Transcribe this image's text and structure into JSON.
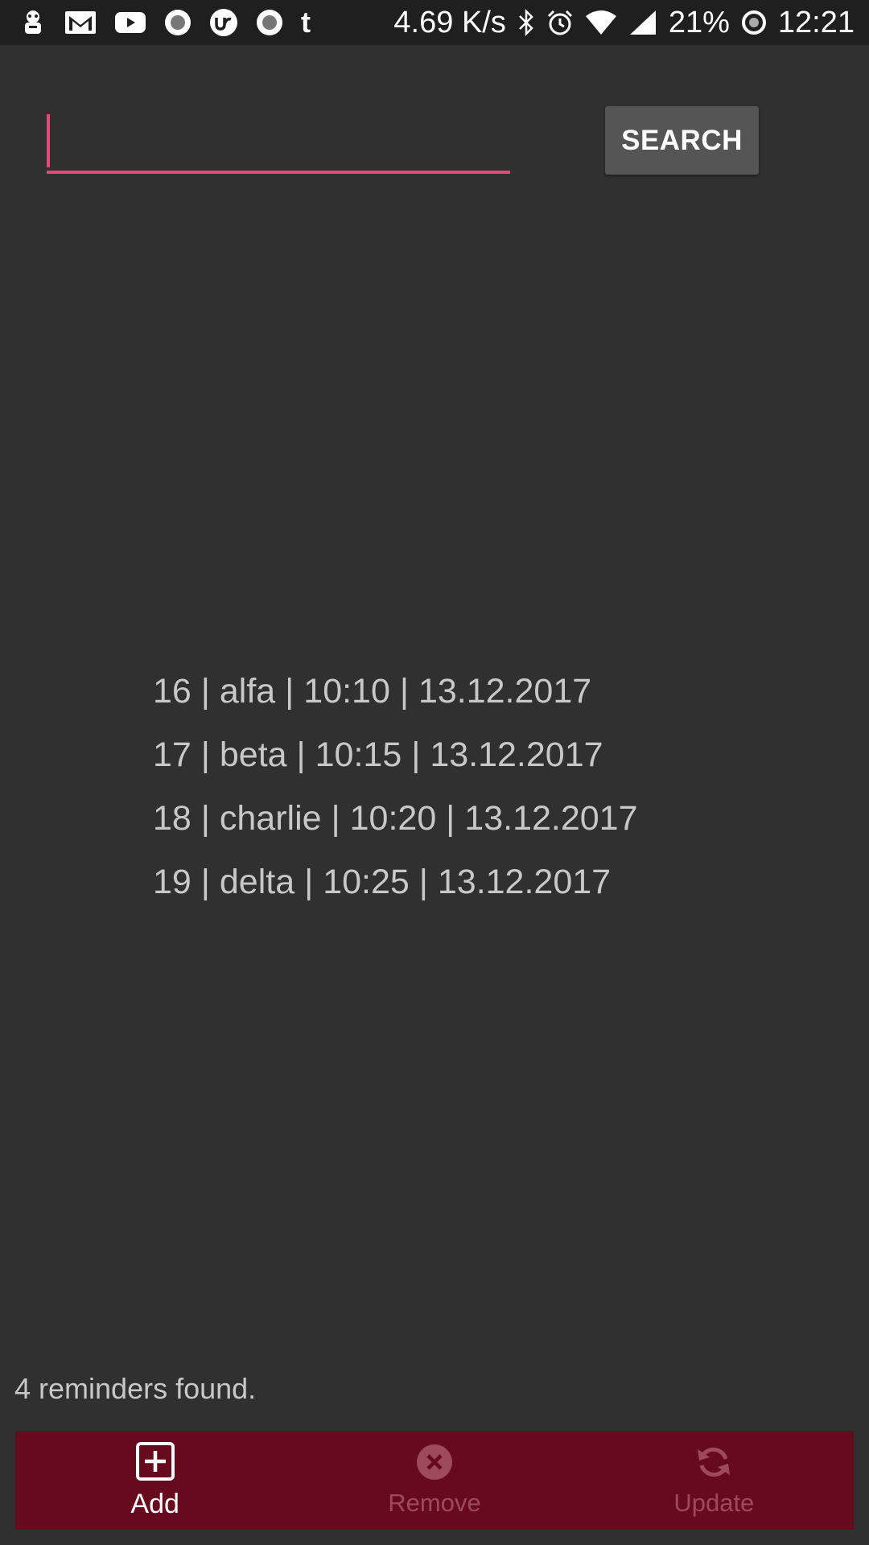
{
  "status_bar": {
    "speed": "4.69 K/s",
    "battery": "21%",
    "time": "12:21",
    "tumblr_glyph": "t",
    "icons": [
      "app-bot-icon",
      "gmail-icon",
      "youtube-icon",
      "record-icon",
      "upwork-icon",
      "record-icon",
      "tumblr-icon",
      "bluetooth-icon",
      "alarm-icon",
      "wifi-icon",
      "signal-icon",
      "battery-saver-icon"
    ]
  },
  "search": {
    "placeholder": "",
    "value": "",
    "button_label": "SEARCH",
    "accent_color": "#e5487a"
  },
  "results": [
    "16 | alfa | 10:10 | 13.12.2017",
    "17 | beta | 10:15 | 13.12.2017",
    "18 | charlie | 10:20 | 13.12.2017",
    "19 | delta | 10:25 | 13.12.2017"
  ],
  "status_text": "4 reminders found.",
  "bottom_nav": {
    "background": "#680a1e",
    "items": [
      {
        "label": "Add",
        "icon": "add-box-icon",
        "active": true
      },
      {
        "label": "Remove",
        "icon": "cancel-circle-icon",
        "active": false
      },
      {
        "label": "Update",
        "icon": "refresh-icon",
        "active": false
      }
    ]
  }
}
